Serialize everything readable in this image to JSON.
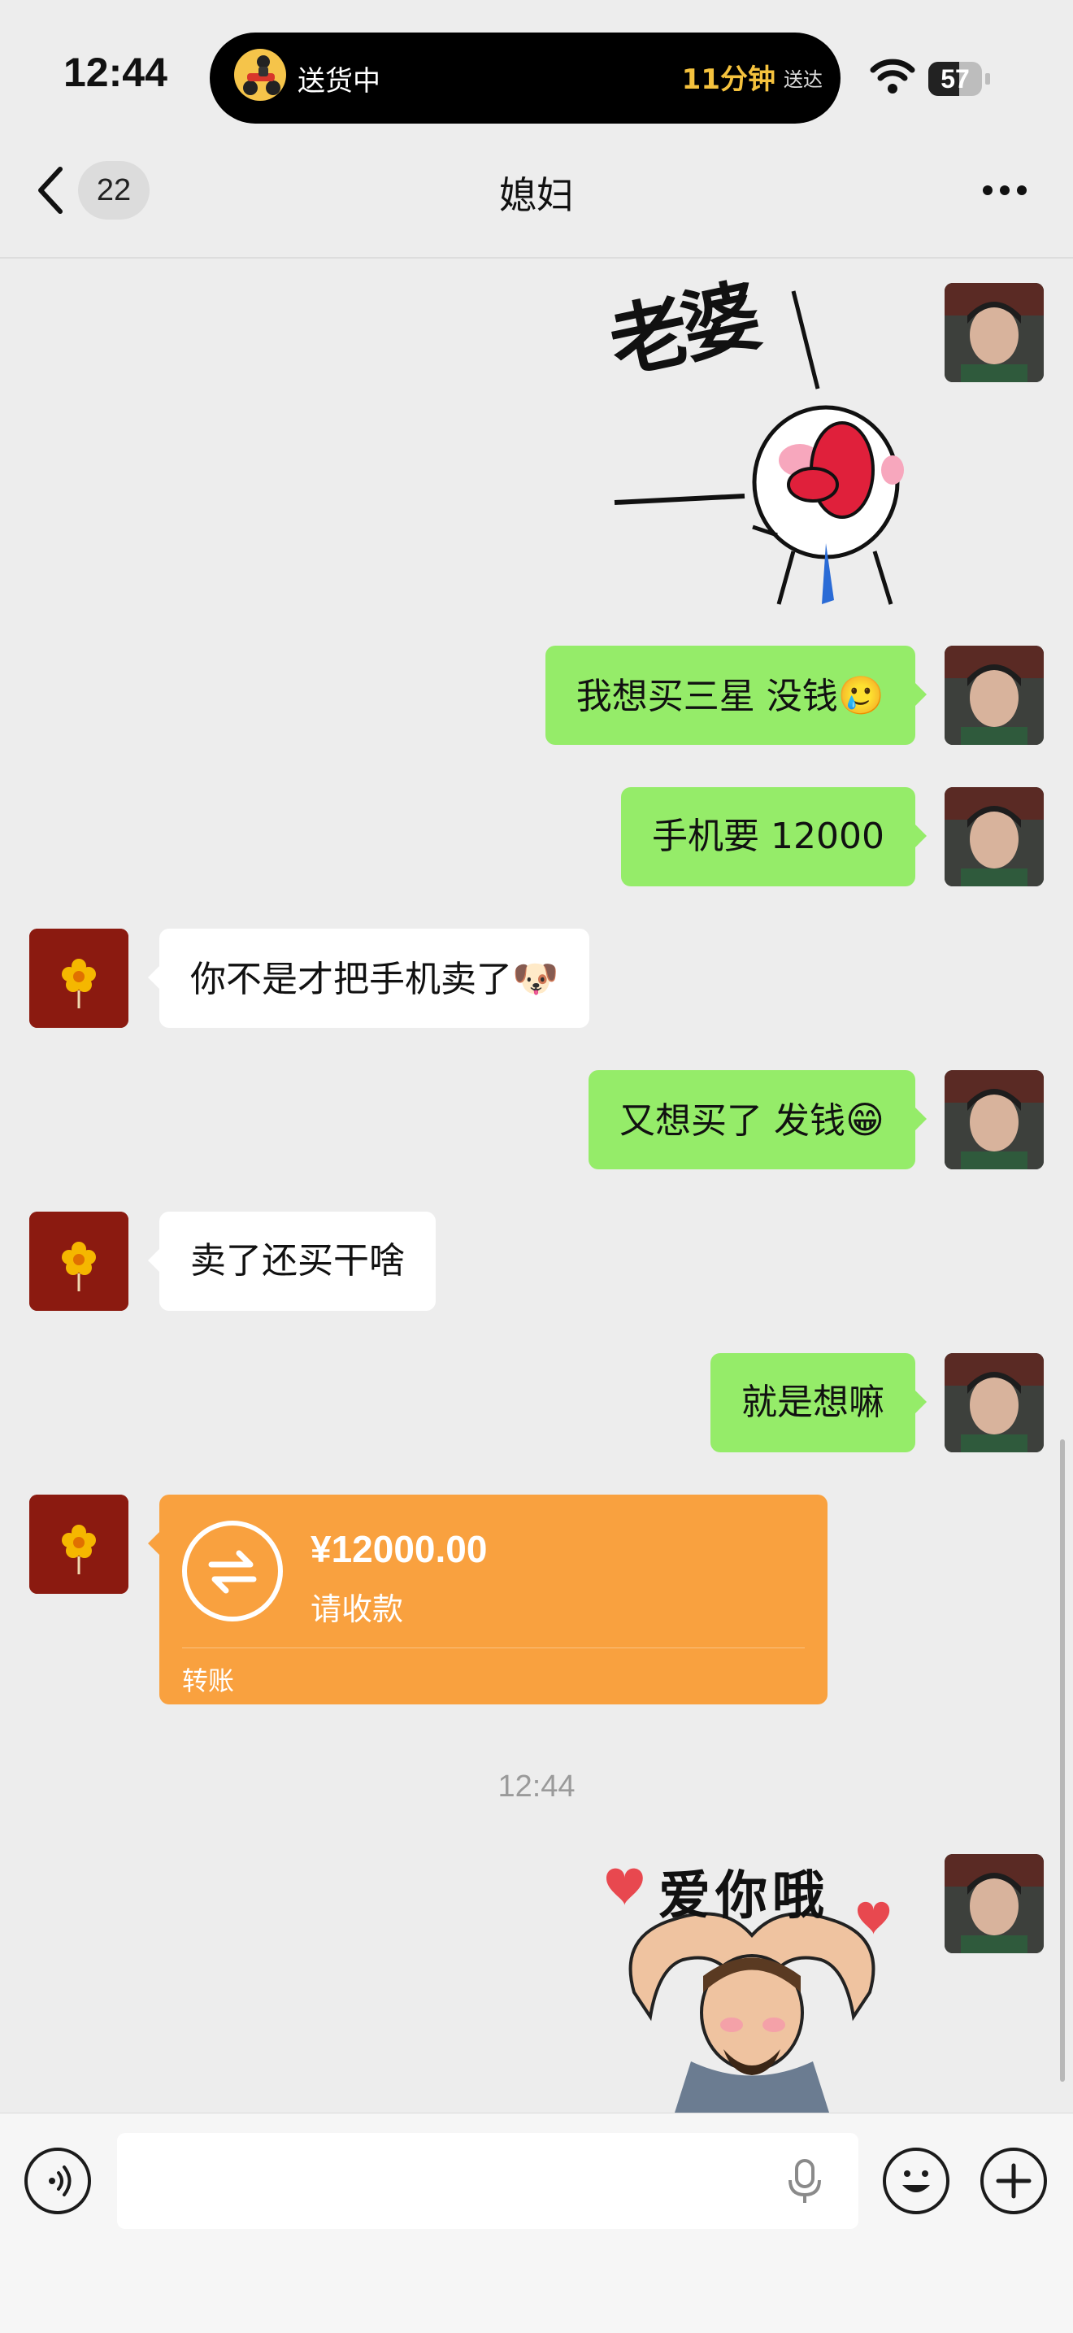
{
  "status_bar": {
    "time": "12:44",
    "live_activity": {
      "label": "送货中",
      "minutes": "11分钟",
      "suffix": "送达"
    },
    "battery_text": "57",
    "battery_level_percent": 57
  },
  "nav": {
    "unread_count": "22",
    "title": "媳妇"
  },
  "messages": [
    {
      "from": "me",
      "type": "sticker",
      "sticker_text": "老婆"
    },
    {
      "from": "me",
      "type": "text",
      "text": "我想买三星 没钱",
      "emoji": "🥲"
    },
    {
      "from": "me",
      "type": "text",
      "text": "手机要 12000"
    },
    {
      "from": "her",
      "type": "text",
      "text": "你不是才把手机卖了",
      "emoji": "🐶"
    },
    {
      "from": "me",
      "type": "text",
      "text": "又想买了 发钱",
      "emoji": "😁"
    },
    {
      "from": "her",
      "type": "text",
      "text": "卖了还买干啥"
    },
    {
      "from": "me",
      "type": "text",
      "text": "就是想嘛"
    },
    {
      "from": "her",
      "type": "transfer",
      "amount": "¥12000.00",
      "status": "请收款",
      "label": "转账"
    },
    {
      "from": "me",
      "type": "sticker",
      "sticker_text": "爱你哦"
    }
  ],
  "timestamp": "12:44",
  "colors": {
    "my_bubble": "#95ec69",
    "her_bubble": "#ffffff",
    "transfer_card": "#f9a13f",
    "background": "#ededed",
    "her_avatar": "#8b1a10"
  },
  "icons": [
    "back-chevron-icon",
    "more-dots-icon",
    "wifi-icon",
    "voice-icon",
    "microphone-icon",
    "emoji-icon",
    "plus-icon",
    "transfer-arrows-icon"
  ]
}
